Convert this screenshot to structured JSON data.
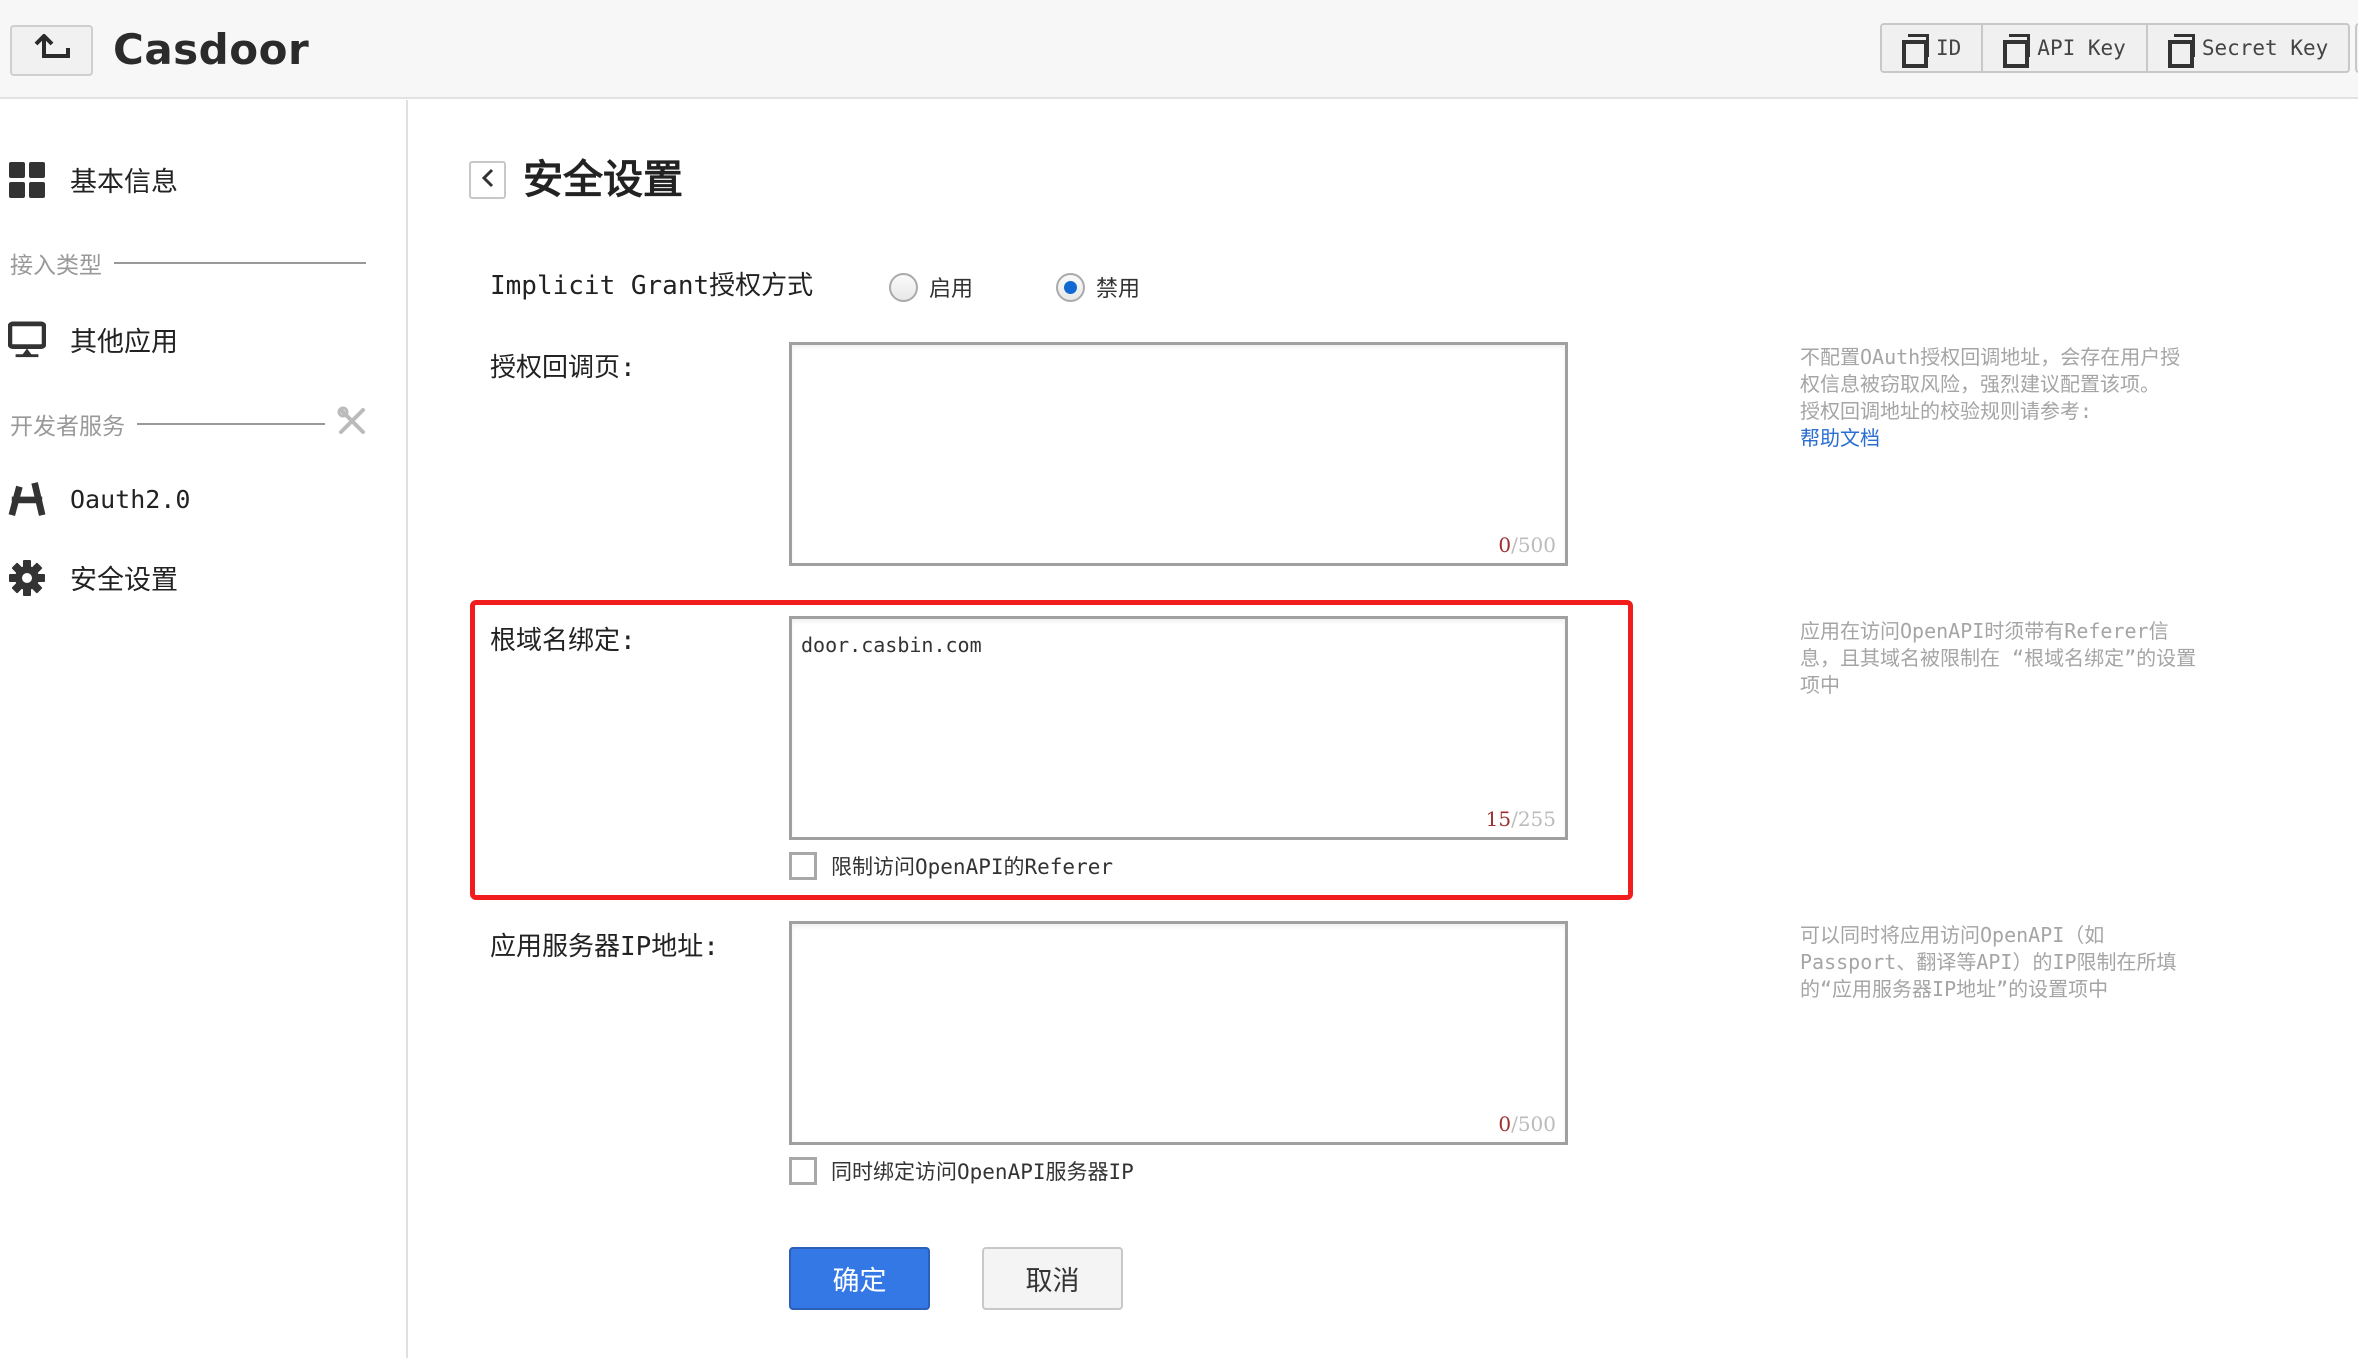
{
  "header": {
    "brand": "Casdoor",
    "back_icon": "return-arrow-icon",
    "key_buttons": [
      {
        "label": "ID",
        "icon": "copy-icon"
      },
      {
        "label": "API Key",
        "icon": "copy-icon"
      },
      {
        "label": "Secret Key",
        "icon": "copy-icon"
      }
    ]
  },
  "sidebar": {
    "items": [
      {
        "label": "基本信息",
        "icon": "grid-icon"
      },
      {
        "label": "其他应用",
        "icon": "monitor-icon"
      },
      {
        "label": "Oauth2.0",
        "icon": "oauth-icon"
      },
      {
        "label": "安全设置",
        "icon": "gear-icon"
      }
    ],
    "sections": [
      {
        "label": "接入类型"
      },
      {
        "label": "开发者服务",
        "icon": "tools-icon"
      }
    ]
  },
  "main": {
    "title": "安全设置",
    "implicit_grant": {
      "label": "Implicit Grant授权方式",
      "options": [
        {
          "label": "启用",
          "selected": false
        },
        {
          "label": "禁用",
          "selected": true
        }
      ]
    },
    "callback": {
      "label": "授权回调页:",
      "value": "",
      "count": "0",
      "max": "/500",
      "hint": "不配置OAuth授权回调地址，会存在用户授权信息被窃取风险，强烈建议配置该项。",
      "hint2": "授权回调地址的校验规则请参考:",
      "hint_link": "帮助文档"
    },
    "domain": {
      "label": "根域名绑定:",
      "value": "door.casbin.com",
      "count": "15",
      "max": "/255",
      "checkbox_label": "限制访问OpenAPI的Referer",
      "checked": false,
      "hint": "应用在访问OpenAPI时须带有Referer信息，且其域名被限制在 “根域名绑定”的设置项中"
    },
    "server_ip": {
      "label": "应用服务器IP地址:",
      "value": "",
      "count": "0",
      "max": "/500",
      "checkbox_label": "同时绑定访问OpenAPI服务器IP",
      "checked": false,
      "hint": "可以同时将应用访问OpenAPI（如Passport、翻译等API）的IP限制在所填的“应用服务器IP地址”的设置项中"
    },
    "confirm_label": "确定",
    "cancel_label": "取消"
  },
  "colors": {
    "primary": "#3478e6",
    "highlight": "#f11c1c",
    "link": "#2a6ed1",
    "hint": "#a5a5a5"
  }
}
